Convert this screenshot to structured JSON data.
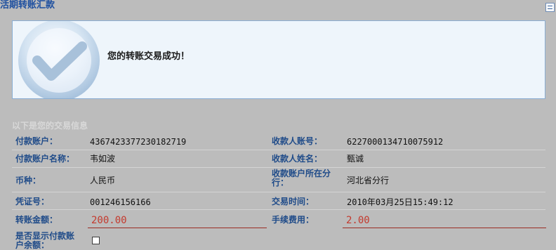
{
  "page": {
    "title": "活期转账汇款"
  },
  "success": {
    "message": "您的转账交易成功！"
  },
  "info": {
    "section_title": "以下是您的交易信息",
    "payer_account_label": "付款账户：",
    "payer_account_value": "4367423377230182719",
    "payee_account_label": "收款人账号：",
    "payee_account_value": "6227000134710075912",
    "payer_name_label": "付款账户名称：",
    "payer_name_value": "韦如波",
    "payee_name_label": "收款人姓名：",
    "payee_name_value": "甄诚",
    "currency_label": "币种：",
    "currency_value": "人民币",
    "payee_branch_label_1": "收款账户所在分",
    "payee_branch_label_2": "行：",
    "payee_branch_value": "河北省分行",
    "voucher_label": "凭证号：",
    "voucher_value": "001246156166",
    "time_label": "交易时间：",
    "time_value": "2010年03月25日15:49:12",
    "amount_label": "转账金额：",
    "amount_value": "200.00",
    "fee_label": "手续费用：",
    "fee_value": "2.00",
    "show_balance_label_1": "是否显示付款账",
    "show_balance_label_2": "户余额："
  }
}
